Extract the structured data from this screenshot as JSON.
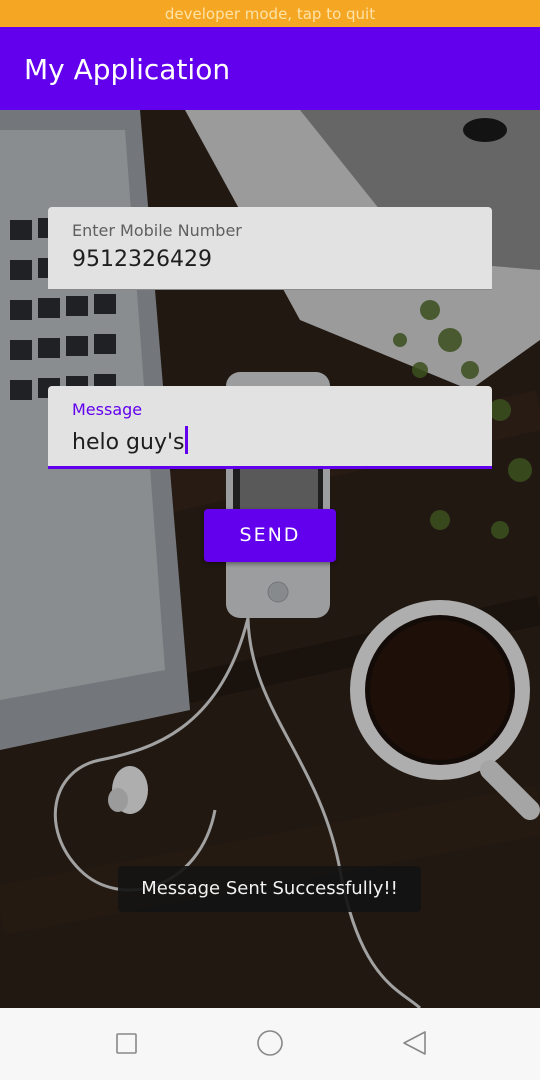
{
  "status": {
    "dev_mode_text": "developer mode, tap to quit"
  },
  "app_bar": {
    "title": "My Application"
  },
  "form": {
    "mobile": {
      "label": "Enter Mobile Number",
      "value": "9512326429"
    },
    "message": {
      "label": "Message",
      "value": "helo guy's"
    },
    "send_label": "SEND"
  },
  "toast": {
    "text": "Message Sent Successfully!!"
  },
  "nav": {
    "recent": "square-icon",
    "home": "circle-icon",
    "back": "triangle-back-icon"
  },
  "colors": {
    "primary": "#6200ee",
    "dev_bar": "#f5a623",
    "field_bg": "#e2e2e2",
    "nav_bg": "#f7f7f7"
  }
}
